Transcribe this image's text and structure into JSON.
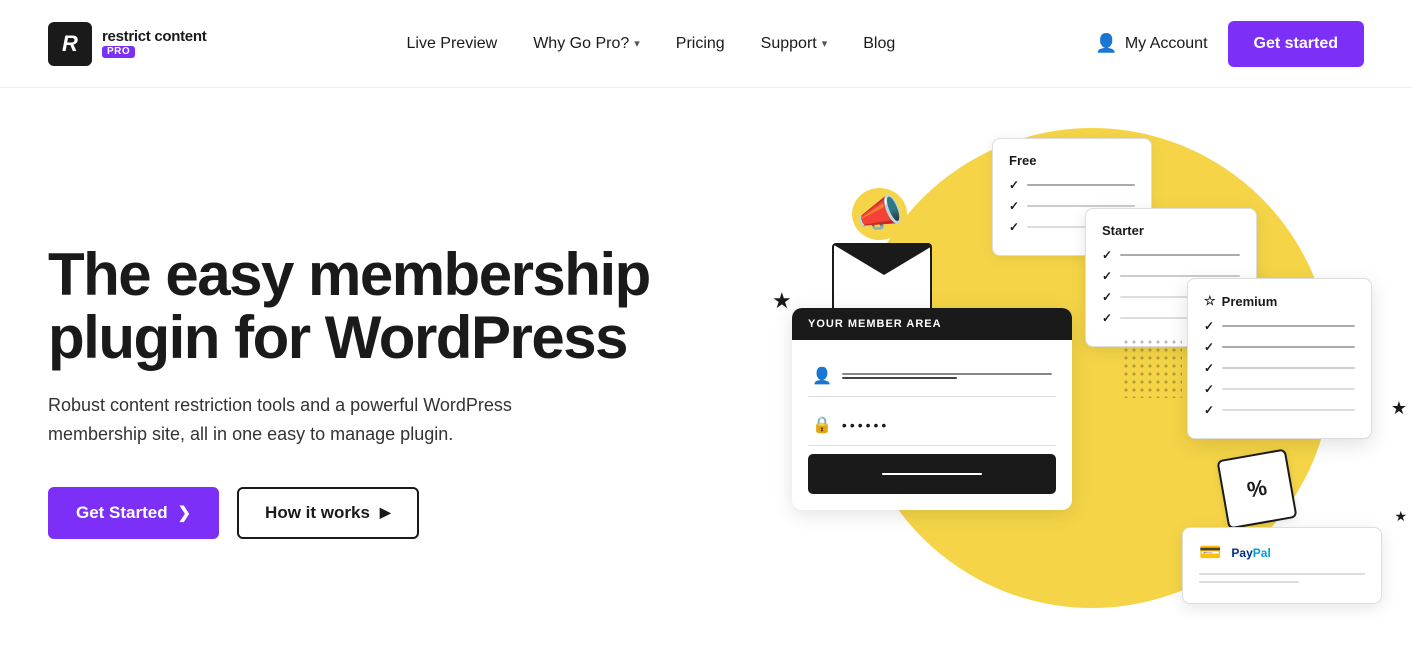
{
  "brand": {
    "icon_text": "R",
    "name_main": "restrict content",
    "name_pro": "PRO"
  },
  "nav": {
    "links": [
      {
        "label": "Live Preview",
        "has_dropdown": false
      },
      {
        "label": "Why Go Pro?",
        "has_dropdown": true
      },
      {
        "label": "Pricing",
        "has_dropdown": false
      },
      {
        "label": "Support",
        "has_dropdown": true
      },
      {
        "label": "Blog",
        "has_dropdown": false
      }
    ],
    "my_account_label": "My Account",
    "get_started_label": "Get started"
  },
  "hero": {
    "title": "The easy membership plugin for WordPress",
    "subtitle": "Robust content restriction tools and a powerful WordPress membership site, all in one easy to manage plugin.",
    "btn_primary": "Get Started",
    "btn_secondary": "How it works",
    "btn_primary_arrow": "❯",
    "btn_secondary_arrow": "▶"
  },
  "illustration": {
    "member_area_header": "YOUR MEMBER AREA",
    "password_dots": "••••••",
    "pricing_free": "Free",
    "pricing_starter": "Starter",
    "pricing_premium": "Premium",
    "paypal_label": "PayPal"
  }
}
